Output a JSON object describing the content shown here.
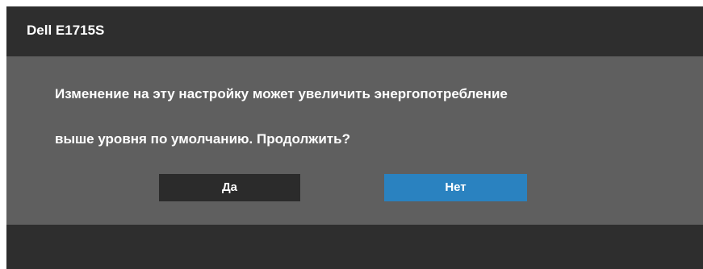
{
  "window": {
    "title": "Dell E1715S"
  },
  "dialog": {
    "message_line1": "Изменение на эту настройку может увеличить энергопотребление",
    "message_line2": "выше уровня по умолчанию. Продолжить?",
    "yes_label": "Да",
    "no_label": "Нет",
    "selected": "no"
  },
  "colors": {
    "title_bar": "#2e2e2e",
    "panel": "#5f5f5f",
    "button_default": "#2b2b2b",
    "button_selected": "#2a82c0",
    "text": "#ffffff"
  }
}
